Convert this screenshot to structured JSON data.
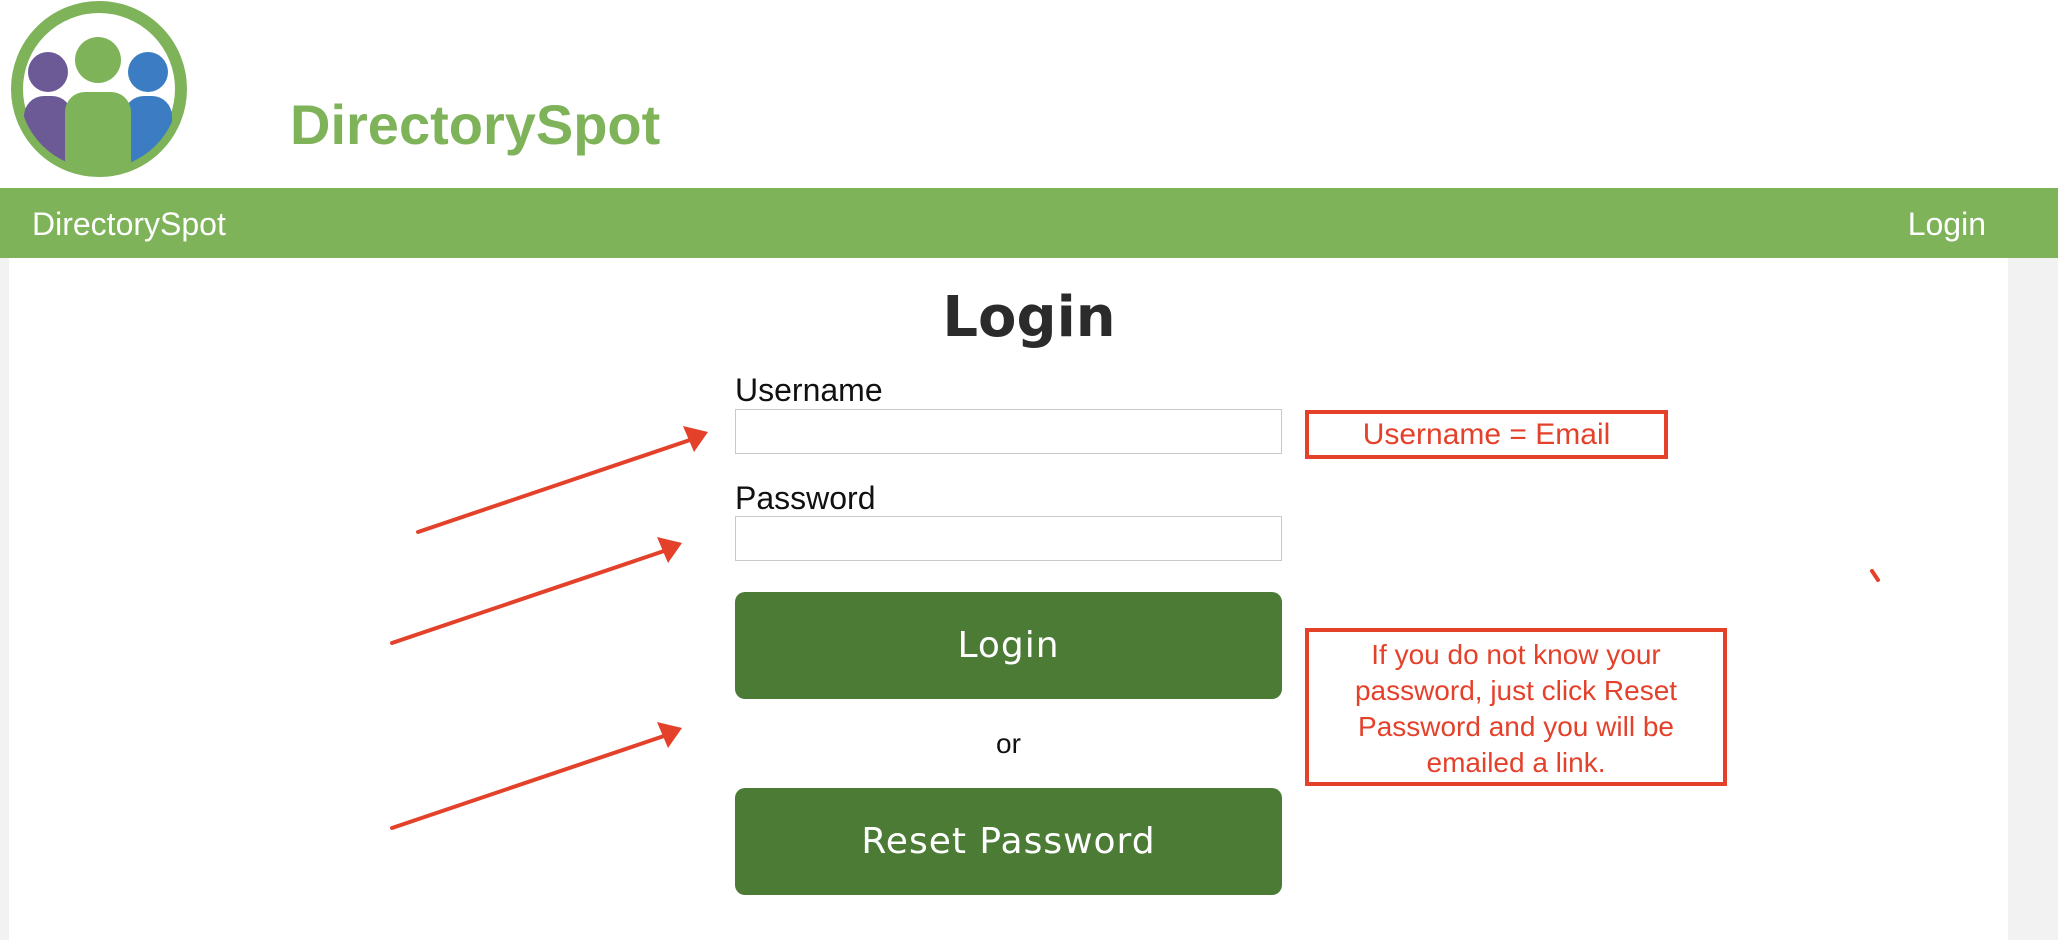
{
  "header": {
    "brand": "DirectorySpot"
  },
  "navbar": {
    "brand": "DirectorySpot",
    "login_link": "Login"
  },
  "login_form": {
    "title": "Login",
    "username_label": "Username",
    "username_value": "",
    "password_label": "Password",
    "password_value": "",
    "login_button": "Login",
    "separator": "or",
    "reset_button": "Reset Password"
  },
  "annotations": {
    "username_note": "Username = Email",
    "password_note": "If you do not know your password, just click Reset Password and you will be emailed a link.",
    "color": "#e4412b"
  },
  "colors": {
    "brand_green": "#7eb35a",
    "button_green": "#4c7b36",
    "logo_purple": "#6b5a96",
    "logo_blue": "#3b7cc3"
  }
}
